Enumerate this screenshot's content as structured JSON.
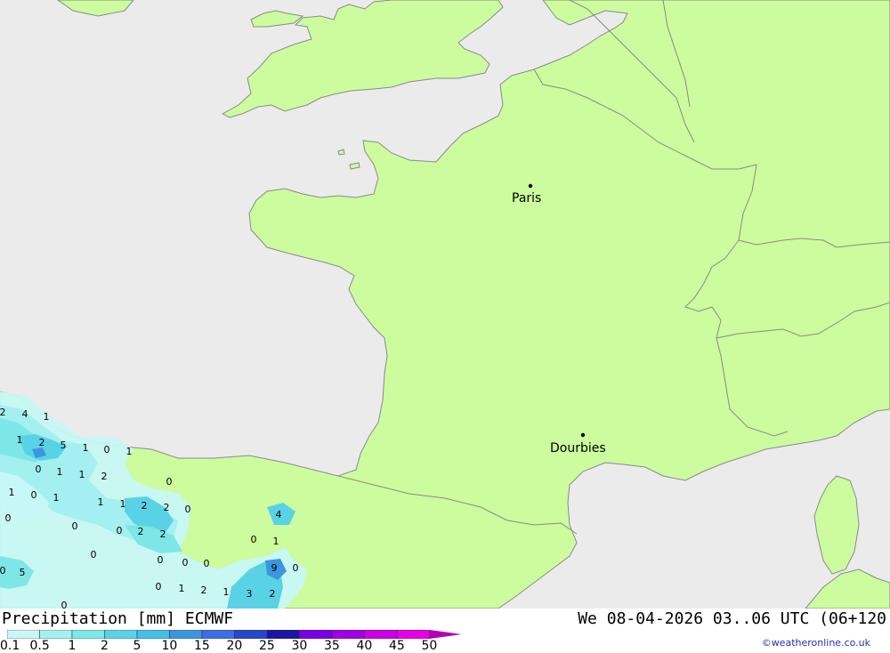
{
  "header": {
    "title": "Precipitation [mm] ECMWF",
    "datetime": "We 08-04-2026 03..06 UTC (06+120"
  },
  "cities": [
    {
      "name": "Paris"
    },
    {
      "name": "Dourbies"
    }
  ],
  "legend": {
    "labels": [
      "0.1",
      "0.5",
      "1",
      "2",
      "5",
      "10",
      "15",
      "20",
      "25",
      "30",
      "35",
      "40",
      "45",
      "50"
    ],
    "colors": [
      "#c8f7f7",
      "#a4f0f0",
      "#7de6e6",
      "#5ad2e6",
      "#46bee6",
      "#3c96dc",
      "#3c6ee6",
      "#2846c8",
      "#1e14a0",
      "#7800e6",
      "#a000e6",
      "#c800e6",
      "#e600e6",
      "#b400b4"
    ]
  },
  "grid_values": [
    "2",
    "4",
    "1",
    "1",
    "2",
    "5",
    "1",
    "0",
    "1",
    "0",
    "1",
    "1",
    "2",
    "1",
    "0",
    "1",
    "0",
    "1",
    "1",
    "2",
    "2",
    "0",
    "0",
    "0",
    "2",
    "2",
    "4",
    "0",
    "0",
    "0",
    "0",
    "0",
    "1",
    "0",
    "0",
    "1",
    "2",
    "1",
    "3",
    "2",
    "9",
    "0",
    "0",
    "5",
    "0"
  ],
  "colors": {
    "sea": "#ebebeb",
    "land": "#ccfc9e",
    "border": "#8a8a8a"
  },
  "copyright": "©weatheronline.co.uk"
}
